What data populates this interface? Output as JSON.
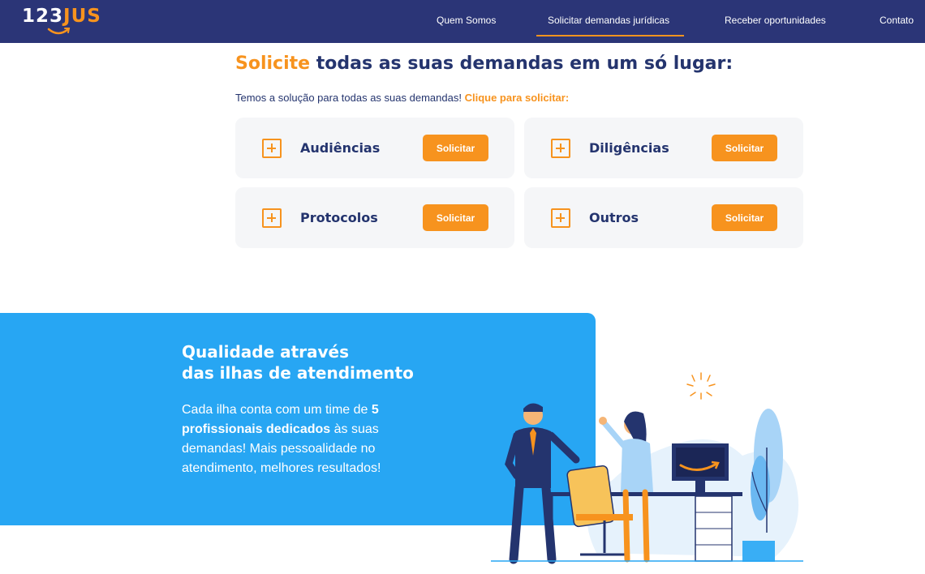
{
  "header": {
    "logo": {
      "num": "123",
      "jus": "JUS"
    },
    "nav": [
      {
        "label": "Quem Somos"
      },
      {
        "label": "Solicitar demandas jurídicas"
      },
      {
        "label": "Receber oportunidades"
      },
      {
        "label": "Contato"
      }
    ],
    "active_index": 1
  },
  "demands": {
    "headline_accent": "Solicite",
    "headline_rest": "todas as suas demandas em um só lugar:",
    "subtitle": "Temos a solução para todas as suas demandas!",
    "subtitle_cta": "Clique para solicitar:",
    "cards": [
      {
        "label": "Audiências",
        "button": "Solicitar"
      },
      {
        "label": "Diligências",
        "button": "Solicitar"
      },
      {
        "label": "Protocolos",
        "button": "Solicitar"
      },
      {
        "label": "Outros",
        "button": "Solicitar"
      }
    ]
  },
  "quality": {
    "title_line1": "Qualidade através",
    "title_line2": "das ilhas de atendimento",
    "body_part1": "Cada ilha conta com um time de",
    "body_bold": "5 profissionais dedicados",
    "body_part2": "às suas demandas! Mais pessoalidade no atendimento, melhores resultados!"
  },
  "colors": {
    "navy": "#2b3577",
    "orange": "#f7931e",
    "blue": "#27a6f3",
    "card_bg": "#f5f6f8"
  }
}
